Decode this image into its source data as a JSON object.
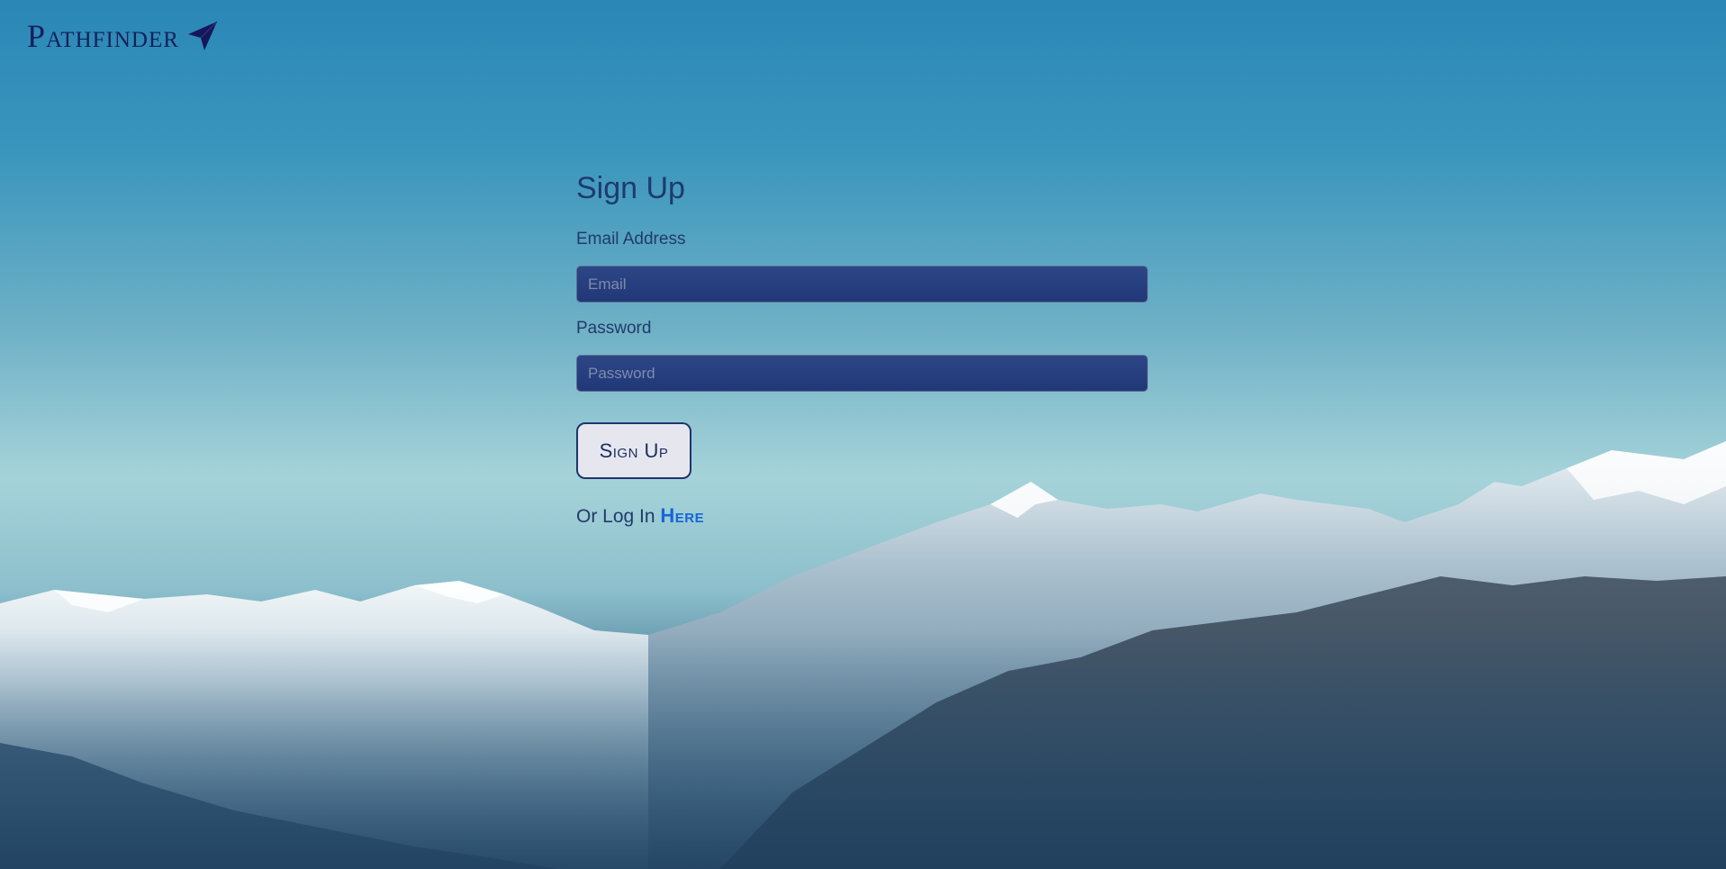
{
  "brand": {
    "name": "Pathfinder",
    "icon": "paper-plane-icon"
  },
  "form": {
    "title": "Sign Up",
    "email": {
      "label": "Email Address",
      "placeholder": "Email",
      "value": ""
    },
    "password": {
      "label": "Password",
      "placeholder": "Password",
      "value": ""
    },
    "submit_label": "Sign Up",
    "login_prompt": "Or Log In",
    "login_link": "Here"
  },
  "colors": {
    "brand": "#16205a",
    "input_bg": "#213877",
    "link": "#1565d8",
    "button_bg": "#e6e7ee"
  }
}
